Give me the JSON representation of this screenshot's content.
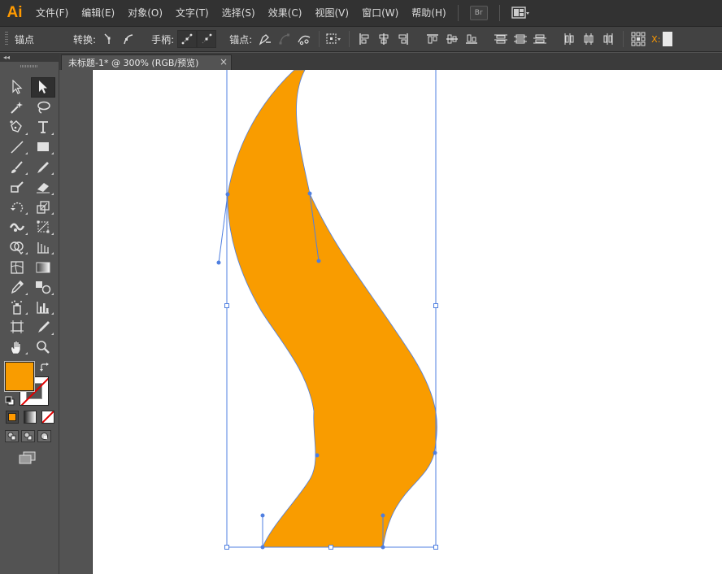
{
  "app": {
    "logo_text": "Ai"
  },
  "menu": {
    "items": [
      "文件(F)",
      "编辑(E)",
      "对象(O)",
      "文字(T)",
      "选择(S)",
      "效果(C)",
      "视图(V)",
      "窗口(W)",
      "帮助(H)"
    ],
    "bridge_button": "Br"
  },
  "control_bar": {
    "anchor_label": "锚点",
    "convert_label": "转换:",
    "handles_label": "手柄:",
    "anchors_label": "锚点:",
    "x_label": "X:",
    "icons": [
      "convert-to-corner-icon",
      "convert-to-smooth-icon",
      "show-handles-icon",
      "hide-handles-icon",
      "remove-anchor-icon",
      "connect-endpoints-icon",
      "cut-path-icon",
      "isolate-object-icon",
      "align-left-icon",
      "align-center-icon",
      "align-right-icon",
      "align-top-icon",
      "align-middle-icon",
      "align-bottom-icon",
      "distribute-top-icon",
      "distribute-middle-icon",
      "distribute-bottom-icon",
      "distribute-left-icon",
      "distribute-center-icon",
      "distribute-right-icon",
      "reference-point-icon"
    ]
  },
  "tools_panel": {
    "collapse_glyph": "◂◂",
    "tools": [
      "selection-tool",
      "direct-selection-tool",
      "magic-wand-tool",
      "lasso-tool",
      "pen-tool",
      "type-tool",
      "line-segment-tool",
      "rectangle-tool",
      "paintbrush-tool",
      "pencil-tool",
      "blob-brush-tool",
      "eraser-tool",
      "rotate-tool",
      "scale-tool",
      "width-tool",
      "free-transform-tool",
      "shape-builder-tool",
      "perspective-grid-tool",
      "mesh-tool",
      "gradient-tool",
      "eyedropper-tool",
      "blend-tool",
      "symbol-sprayer-tool",
      "column-graph-tool",
      "artboard-tool",
      "slice-tool",
      "hand-tool",
      "zoom-tool"
    ],
    "active_tool": "direct-selection-tool"
  },
  "document": {
    "tab_title": "未标题-1* @ 300% (RGB/预览)",
    "close_glyph": "×"
  },
  "colors": {
    "fill": "#f99c00",
    "stroke": "none",
    "accent": "#ff9a00",
    "selection": "#4f7fe0",
    "canvas_bg": "#ffffff",
    "ui_bg": "#535353"
  }
}
